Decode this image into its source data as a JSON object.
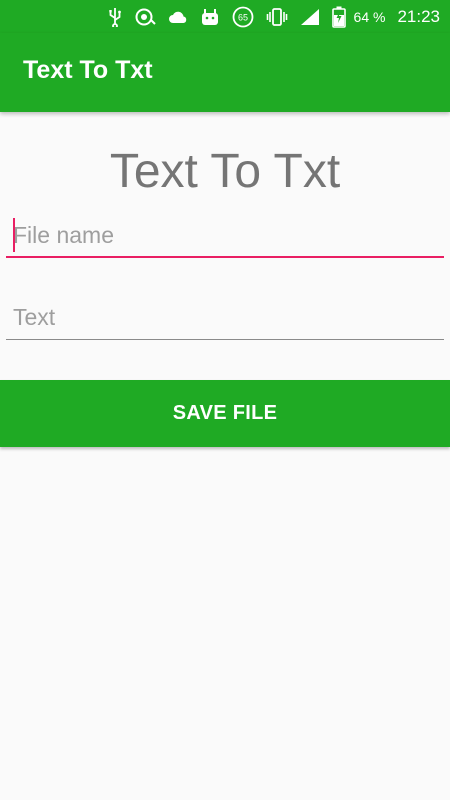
{
  "status_bar": {
    "icons": [
      "usb-icon",
      "sync-icon",
      "cloud-icon",
      "android-icon",
      "data-usage-icon",
      "vibrate-icon",
      "signal-icon",
      "battery-charging-icon"
    ],
    "data_usage_value": "65",
    "battery_percent": "64 %",
    "time": "21:23"
  },
  "app_bar": {
    "title": "Text To Txt"
  },
  "main": {
    "heading": "Text To Txt",
    "filename_field": {
      "value": "",
      "placeholder": "File name"
    },
    "text_field": {
      "value": "",
      "placeholder": "Text"
    },
    "save_button_label": "SAVE FILE"
  },
  "colors": {
    "primary": "#1faa24",
    "accent": "#e91e63",
    "heading": "#757575",
    "background": "#fafafa"
  }
}
